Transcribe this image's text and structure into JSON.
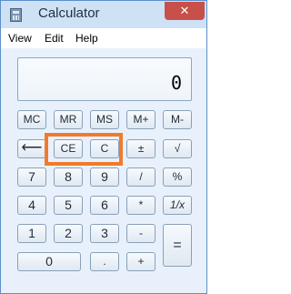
{
  "window": {
    "title": "Calculator",
    "close_label": "✕"
  },
  "menubar": {
    "items": [
      "View",
      "Edit",
      "Help"
    ]
  },
  "display": {
    "value": "0"
  },
  "buttons": {
    "mc": "MC",
    "mr": "MR",
    "ms": "MS",
    "mplus": "M+",
    "mminus": "M-",
    "backspace": "⟵",
    "ce": "CE",
    "c": "C",
    "plusminus": "±",
    "sqrt": "√",
    "seven": "7",
    "eight": "8",
    "nine": "9",
    "divide": "/",
    "percent": "%",
    "four": "4",
    "five": "5",
    "six": "6",
    "multiply": "*",
    "reciprocal": "1/x",
    "one": "1",
    "two": "2",
    "three": "3",
    "minus": "-",
    "equals": "=",
    "zero": "0",
    "decimal": ".",
    "plus": "+"
  },
  "highlight": {
    "color": "#ef7b2f"
  },
  "colors": {
    "accent": "#5b8fc9",
    "close_button": "#c7504a"
  }
}
